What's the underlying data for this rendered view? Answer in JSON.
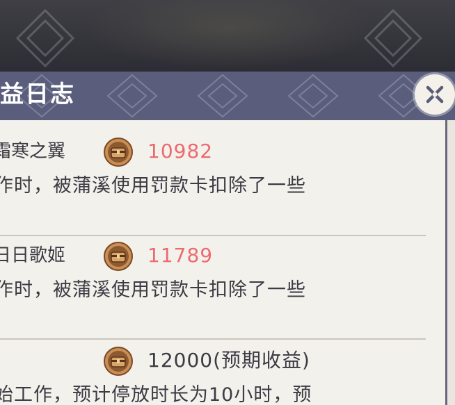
{
  "panel": {
    "title": "益日志"
  },
  "entries": [
    {
      "name": "霜寒之翼",
      "amount": "10982",
      "description": "作时，被蒲溪使用罚款卡扣除了一些"
    },
    {
      "name": "日日歌姬",
      "amount": "11789",
      "description": "作时，被蒲溪使用罚款卡扣除了一些"
    },
    {
      "name": "",
      "amount": "12000(预期收益)",
      "description": "始工作，预计停放时长为10小时，预"
    }
  ],
  "icons": {
    "close": "close-icon",
    "coin": "coin-chest-icon"
  },
  "colors": {
    "header": "#5a5d7c",
    "body": "#f3f1ec",
    "negative_amount": "#ec6a6e",
    "text": "#3c3a42"
  }
}
